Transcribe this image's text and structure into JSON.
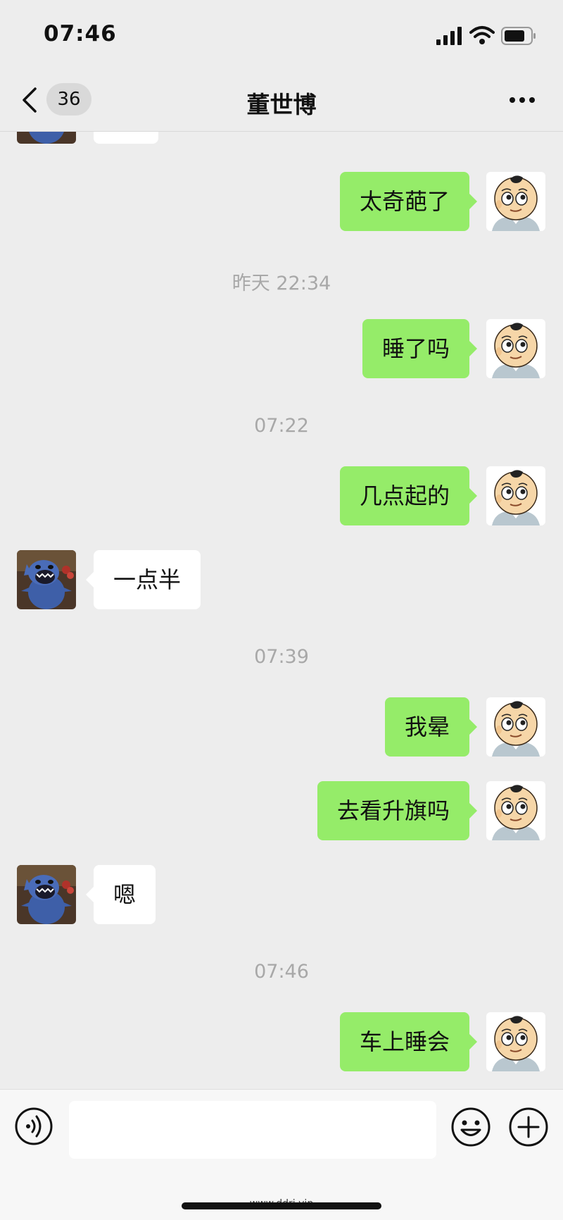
{
  "status_bar": {
    "time": "07:46"
  },
  "nav": {
    "unread_count": "36",
    "title": "董世博"
  },
  "messages": {
    "m1": "太奇葩了",
    "ts1": "昨天 22:34",
    "m2": "睡了吗",
    "ts2": "07:22",
    "m3": "几点起的",
    "m4": "一点半",
    "ts3": "07:39",
    "m5": "我晕",
    "m6": "去看升旗吗",
    "m7": "嗯",
    "ts4": "07:46",
    "m8": "车上睡会"
  },
  "input_bar": {
    "value": ""
  },
  "watermark": "www.ddrj.vip",
  "colors": {
    "sent_bubble": "#95ec69",
    "received_bubble": "#ffffff",
    "background": "#ededed"
  },
  "icons": [
    "back-icon",
    "more-icon",
    "voice-icon",
    "emoji-icon",
    "plus-icon",
    "signal-icon",
    "wifi-icon",
    "battery-icon"
  ]
}
